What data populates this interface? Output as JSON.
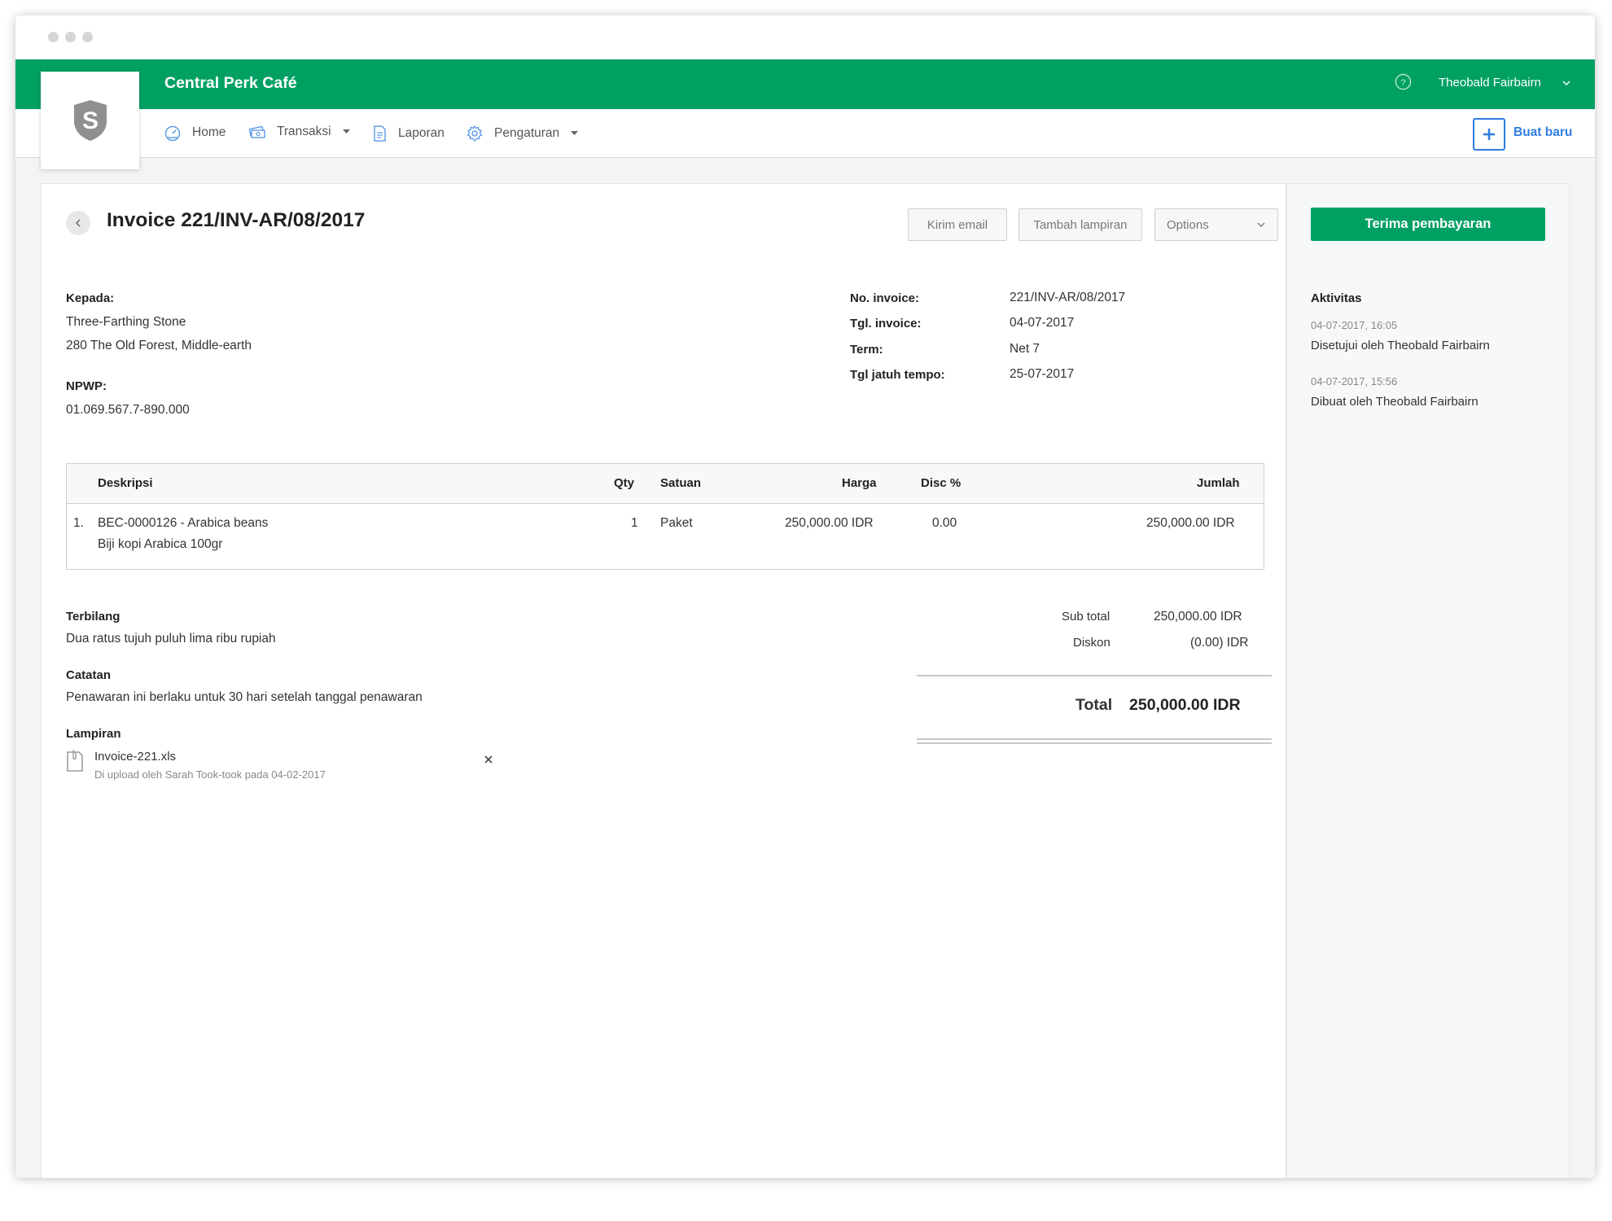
{
  "app": {
    "title": "Central Perk Café",
    "user_name": "Theobald Fairbairn",
    "accent_color": "#00a063",
    "link_color": "#2f7de1"
  },
  "nav": {
    "items": [
      {
        "label": "Home",
        "icon": "dashboard-gauge-icon"
      },
      {
        "label": "Transaksi",
        "icon": "transactions-icon"
      },
      {
        "label": "Laporan",
        "icon": "report-document-icon"
      },
      {
        "label": "Pengaturan",
        "icon": "settings-gear-icon"
      }
    ],
    "new_label": "Buat baru"
  },
  "invoice": {
    "title": "Invoice 221/INV-AR/08/2017",
    "actions": {
      "email": "Kirim email",
      "attach": "Tambah lampiran",
      "options": "Options"
    },
    "to_label": "Kepada:",
    "to_name": "Three-Farthing Stone",
    "to_address": "280 The Old Forest, Middle-earth",
    "npwp_label": "NPWP:",
    "npwp_value": "01.069.567.7-890.000",
    "meta": {
      "no_label": "No. invoice:",
      "no_value": "221/INV-AR/08/2017",
      "date_label": "Tgl. invoice:",
      "date_value": "04-07-2017",
      "term_label": "Term:",
      "term_value": "Net 7",
      "due_label": "Tgl jatuh tempo:",
      "due_value": "25-07-2017"
    },
    "table": {
      "headers": {
        "desc": "Deskripsi",
        "qty": "Qty",
        "unit": "Satuan",
        "price": "Harga",
        "disc": "Disc %",
        "amount": "Jumlah"
      },
      "rows": [
        {
          "no": "1.",
          "desc": "BEC-0000126 - Arabica beans",
          "subdesc": "Biji kopi Arabica 100gr",
          "qty": "1",
          "unit": "Paket",
          "price": "250,000.00 IDR",
          "disc": "0.00",
          "amount": "250,000.00 IDR"
        }
      ]
    },
    "spelled_label": "Terbilang",
    "spelled_value": "Dua ratus tujuh puluh lima ribu rupiah",
    "notes_label": "Catatan",
    "notes_value": "Penawaran ini berlaku untuk 30 hari setelah tanggal penawaran",
    "attach_label": "Lampiran",
    "attachment": {
      "name": "Invoice-221.xls",
      "meta": "Di upload oleh Sarah Took-took pada 04-02-2017"
    },
    "totals": {
      "subtotal_label": "Sub total",
      "subtotal_value": "250,000.00 IDR",
      "discount_label": "Diskon",
      "discount_value": "(0.00) IDR",
      "total_label": "Total",
      "total_value": "250,000.00 IDR"
    }
  },
  "side": {
    "pay_button": "Terima pembayaran",
    "activity_label": "Aktivitas",
    "activities": [
      {
        "time": "04-07-2017, 16:05",
        "text": "Disetujui oleh Theobald Fairbairn"
      },
      {
        "time": "04-07-2017, 15:56",
        "text": "Dibuat oleh Theobald Fairbairn"
      }
    ]
  }
}
